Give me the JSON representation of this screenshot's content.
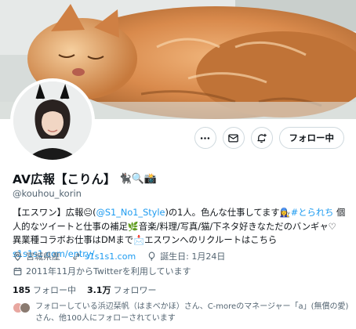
{
  "profile": {
    "display_name": "AV広報【こりん】",
    "name_emojis": "🐈‍⬛🔍📸",
    "handle": "@kouhou_korin",
    "bio": {
      "p1": "【エスワン】広報😐(",
      "mention": "@S1_No1_Style",
      "p2": ")の1人。色んな仕事してます👩‍🔧",
      "hashtag": "#とられち",
      "p3": " 個人的なツイートと仕事の補足🌿音楽/料理/写真/猫/下ネタ好きなただのバンギャ♡ 異業種コラボお仕事はDMまで📩エスワンへのリクルートはこちら",
      "link": "s1s1s1.com/entry/"
    },
    "location": "宮城県産",
    "website": "s1s1s1.com",
    "birthday": "誕生日: 1月24日",
    "joined": "2011年11月からTwitterを利用しています",
    "following_count": "185",
    "following_label": "フォロー中",
    "followers_count": "3.1万",
    "followers_label": "フォロワー",
    "followed_by_text": "フォローしている浜辺栞帆（はまべかほ）さん、C-moreのマネージャー「a」(無償の愛)さん、他100人にフォローされています"
  },
  "actions": {
    "more_icon": "more-icon",
    "message_icon": "envelope-icon",
    "notify_icon": "bell-plus-icon",
    "follow_label": "フォロー中"
  },
  "colors": {
    "link": "#1d9bf0",
    "secondary_text": "#536471",
    "border": "#cfd9de"
  }
}
